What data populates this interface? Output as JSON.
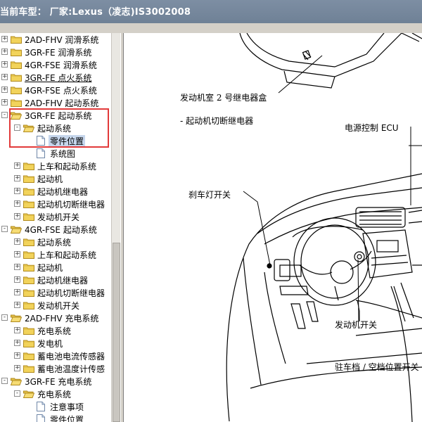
{
  "title": "当前车型： 厂家:Lexus（凌志)IS3002008",
  "tree": [
    {
      "label": "2AD-FHV 润滑系统",
      "level": 0,
      "expander": "+",
      "icon": "folder-closed"
    },
    {
      "label": "3GR-FE 润滑系统",
      "level": 0,
      "expander": "+",
      "icon": "folder-closed"
    },
    {
      "label": "4GR-FSE 润滑系统",
      "level": 0,
      "expander": "+",
      "icon": "folder-closed"
    },
    {
      "label": "3GR-FE 点火系统",
      "level": 0,
      "expander": "+",
      "icon": "folder-closed",
      "underline": true
    },
    {
      "label": "4GR-FSE 点火系统",
      "level": 0,
      "expander": "+",
      "icon": "folder-closed"
    },
    {
      "label": "2AD-FHV 起动系统",
      "level": 0,
      "expander": "+",
      "icon": "folder-closed"
    },
    {
      "label": "3GR-FE 起动系统",
      "level": 0,
      "expander": "-",
      "icon": "folder-open"
    },
    {
      "label": "起动系统",
      "level": 1,
      "expander": "-",
      "icon": "folder-open"
    },
    {
      "label": "零件位置",
      "level": 2,
      "expander": "",
      "icon": "document",
      "selected": true
    },
    {
      "label": "系统图",
      "level": 2,
      "expander": "",
      "icon": "document"
    },
    {
      "label": "上车和起动系统",
      "level": 1,
      "expander": "+",
      "icon": "folder-closed"
    },
    {
      "label": "起动机",
      "level": 1,
      "expander": "+",
      "icon": "folder-closed"
    },
    {
      "label": "起动机继电器",
      "level": 1,
      "expander": "+",
      "icon": "folder-closed"
    },
    {
      "label": "起动机切断继电器",
      "level": 1,
      "expander": "+",
      "icon": "folder-closed"
    },
    {
      "label": "发动机开关",
      "level": 1,
      "expander": "+",
      "icon": "folder-closed"
    },
    {
      "label": "4GR-FSE 起动系统",
      "level": 0,
      "expander": "-",
      "icon": "folder-open"
    },
    {
      "label": "起动系统",
      "level": 1,
      "expander": "+",
      "icon": "folder-closed"
    },
    {
      "label": "上车和起动系统",
      "level": 1,
      "expander": "+",
      "icon": "folder-closed"
    },
    {
      "label": "起动机",
      "level": 1,
      "expander": "+",
      "icon": "folder-closed"
    },
    {
      "label": "起动机继电器",
      "level": 1,
      "expander": "+",
      "icon": "folder-closed"
    },
    {
      "label": "起动机切断继电器",
      "level": 1,
      "expander": "+",
      "icon": "folder-closed"
    },
    {
      "label": "发动机开关",
      "level": 1,
      "expander": "+",
      "icon": "folder-closed"
    },
    {
      "label": "2AD-FHV 充电系统",
      "level": 0,
      "expander": "-",
      "icon": "folder-open"
    },
    {
      "label": "充电系统",
      "level": 1,
      "expander": "+",
      "icon": "folder-closed"
    },
    {
      "label": "发电机",
      "level": 1,
      "expander": "+",
      "icon": "folder-closed"
    },
    {
      "label": "蓄电池电流传感器",
      "level": 1,
      "expander": "+",
      "icon": "folder-closed"
    },
    {
      "label": "蓄电池温度计传感",
      "level": 1,
      "expander": "+",
      "icon": "folder-closed"
    },
    {
      "label": "3GR-FE 充电系统",
      "level": 0,
      "expander": "-",
      "icon": "folder-open"
    },
    {
      "label": "充电系统",
      "level": 1,
      "expander": "-",
      "icon": "folder-open"
    },
    {
      "label": "注意事项",
      "level": 2,
      "expander": "",
      "icon": "document"
    },
    {
      "label": "零件位置",
      "level": 2,
      "expander": "",
      "icon": "document"
    }
  ],
  "diagram": {
    "callouts": {
      "relay_box": "发动机室 2 号继电器盒",
      "cutoff_relay": "- 起动机切断继电器",
      "power_ecu": "电源控制 ECU",
      "brake_switch": "刹车灯开关",
      "engine_switch": "发动机开关",
      "park_neutral": "驻车档 / 空档位置开关"
    }
  }
}
